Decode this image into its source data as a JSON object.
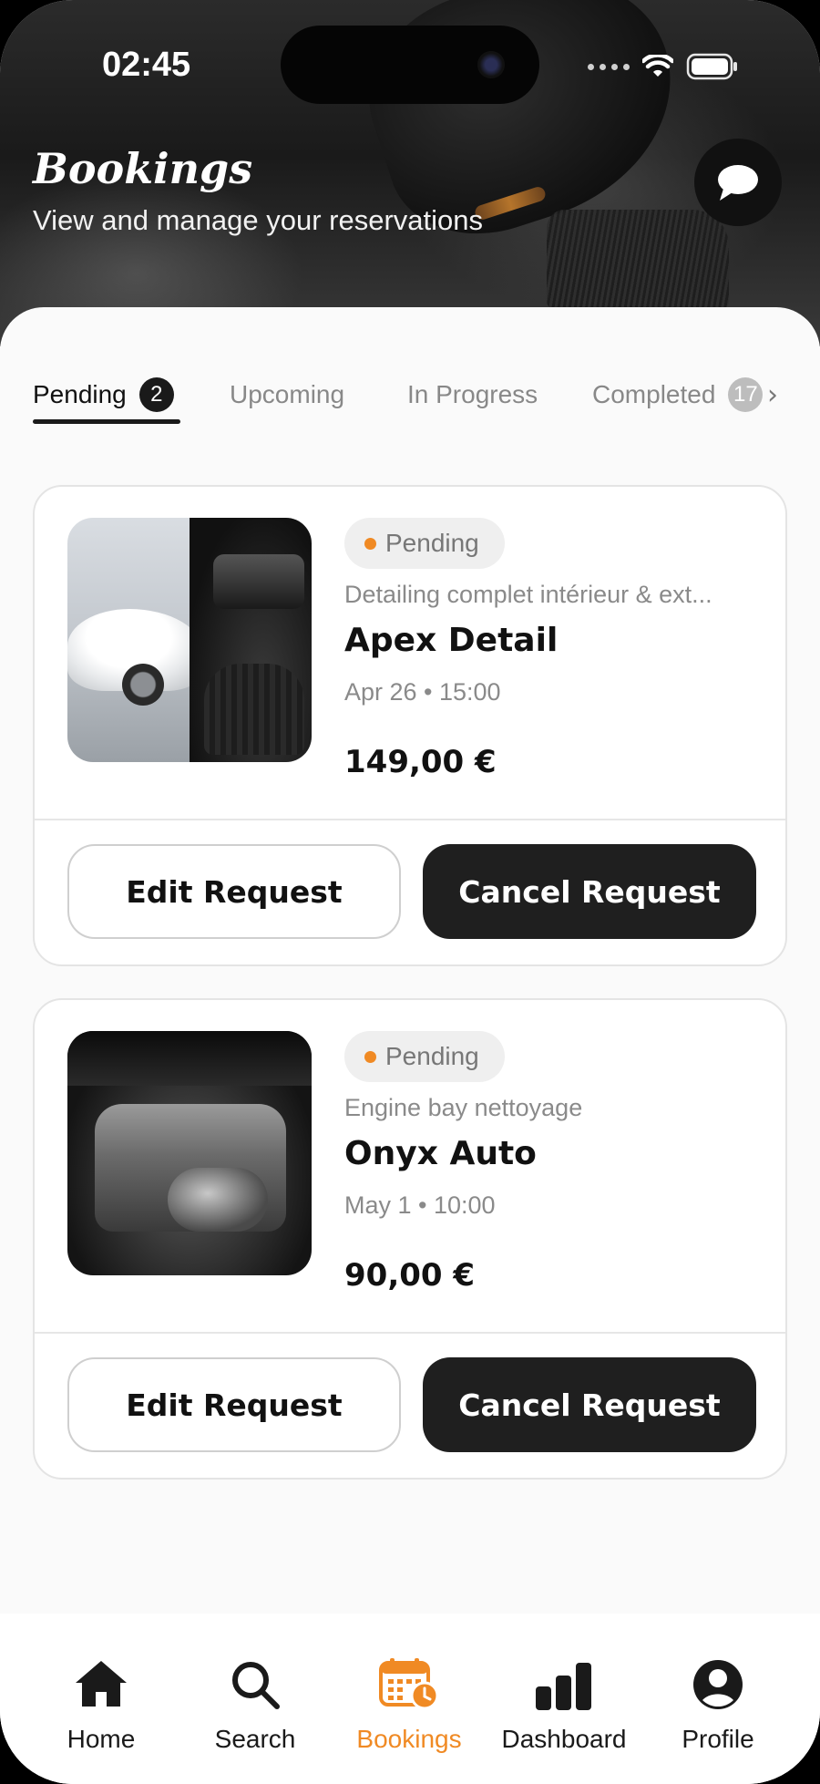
{
  "status_bar": {
    "time": "02:45"
  },
  "header": {
    "title": "Bookings",
    "subtitle": "View and manage your reservations"
  },
  "tabs": [
    {
      "label": "Pending",
      "count": "2",
      "active": true
    },
    {
      "label": "Upcoming"
    },
    {
      "label": "In Progress"
    },
    {
      "label": "Completed",
      "count": "17"
    }
  ],
  "bookings": [
    {
      "status": "Pending",
      "service": "Detailing complet intérieur & ext...",
      "shop": "Apex Detail",
      "when": "Apr 26 • 15:00",
      "price": "149,00 €",
      "edit_label": "Edit Request",
      "cancel_label": "Cancel Request"
    },
    {
      "status": "Pending",
      "service": "Engine bay nettoyage",
      "shop": "Onyx Auto",
      "when": "May 1 • 10:00",
      "price": "90,00 €",
      "edit_label": "Edit Request",
      "cancel_label": "Cancel Request"
    }
  ],
  "nav": [
    {
      "label": "Home",
      "icon": "home-icon"
    },
    {
      "label": "Search",
      "icon": "search-icon"
    },
    {
      "label": "Bookings",
      "icon": "calendar-clock-icon",
      "active": true
    },
    {
      "label": "Dashboard",
      "icon": "bar-chart-icon"
    },
    {
      "label": "Profile",
      "icon": "user-circle-icon"
    }
  ],
  "colors": {
    "accent": "#f08a24",
    "dark": "#1f1f1f",
    "pending_dot": "#f08a24"
  }
}
